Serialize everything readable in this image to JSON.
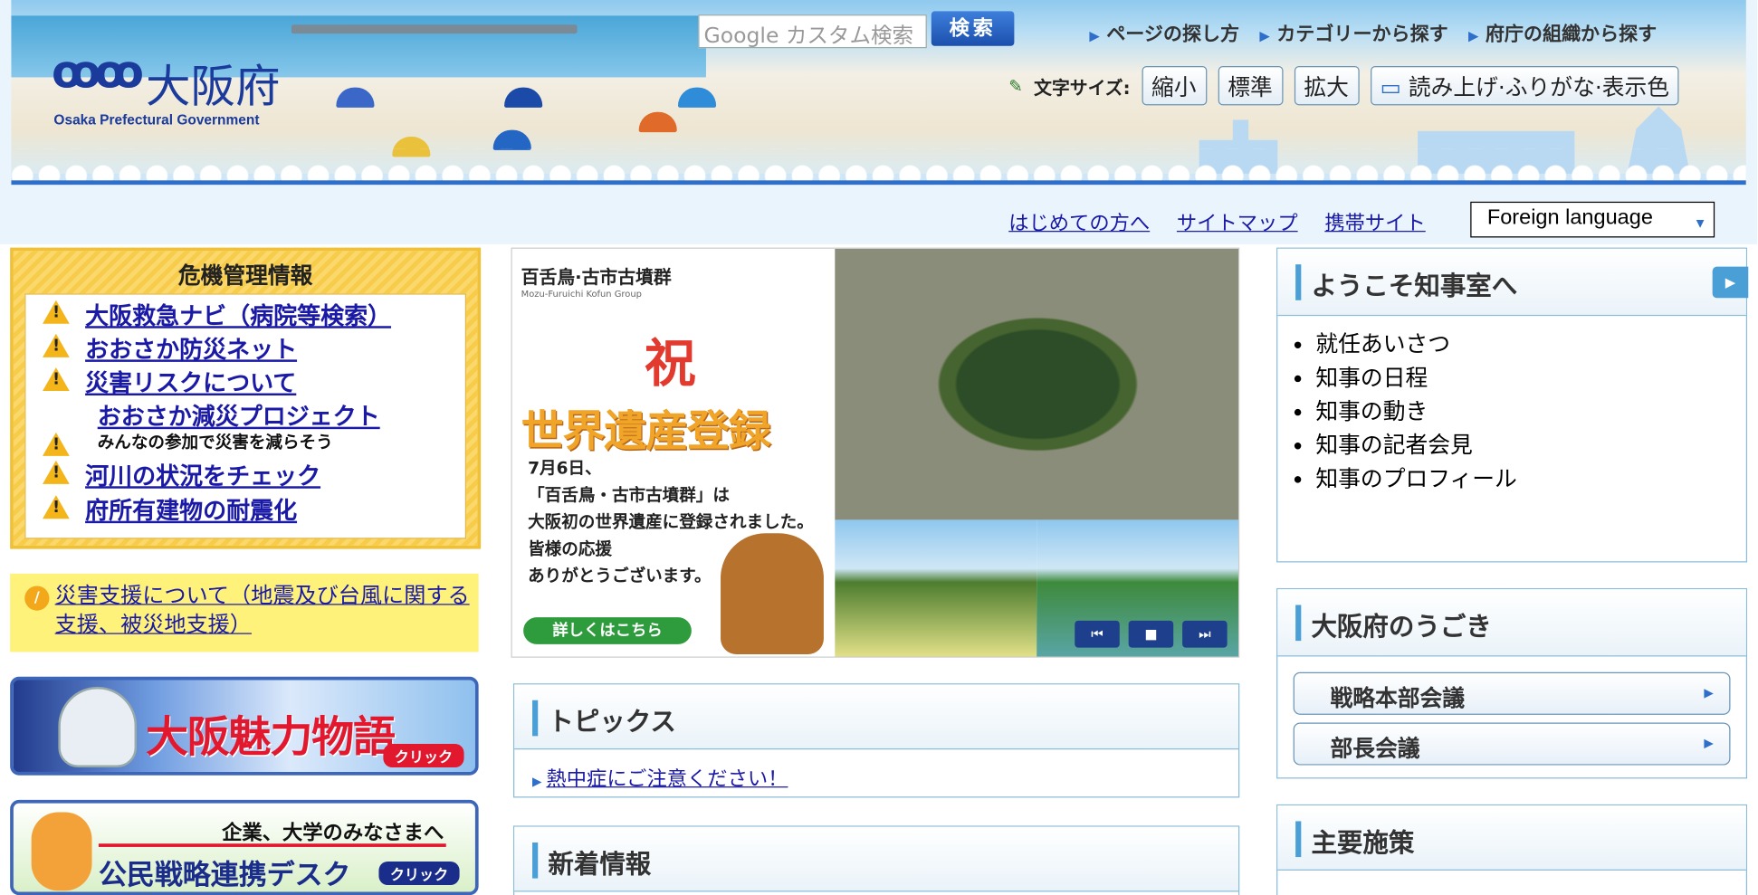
{
  "header": {
    "logo_jp": "大阪府",
    "logo_en": "Osaka Prefectural Government",
    "search_placeholder": "Google カスタム検索",
    "search_button": "検索",
    "top_links": [
      "ページの探し方",
      "カテゴリーから探す",
      "府庁の組織から探す"
    ],
    "font_size_label": "文字サイズ:",
    "font_buttons": [
      "縮小",
      "標準",
      "拡大"
    ],
    "accessibility_button": "読み上げ·ふりがな·表示色",
    "sub_links": [
      "はじめての方へ",
      "サイトマップ",
      "携帯サイト"
    ],
    "language_select": "Foreign language"
  },
  "crisis": {
    "title": "危機管理情報",
    "items": [
      "大阪救急ナビ（病院等検索）",
      "おおさか防災ネット",
      "災害リスクについて",
      "おおさか減災プロジェクト",
      "河川の状況をチェック",
      "府所有建物の耐震化"
    ],
    "sub_note": "みんなの参加で災害を減らそう"
  },
  "support_link": "災害支援について（地震及び台風に関する支援、被災地支援）",
  "banners": {
    "miryoku": {
      "title": "大阪魅力物語",
      "click": "クリック"
    },
    "desk": {
      "subtitle": "企業、大学のみなさまへ",
      "title": "公民戦略連携デスク",
      "click": "クリック"
    }
  },
  "slide": {
    "site_name": "百舌鳥·古市古墳群",
    "site_small": "Mozu-Furuichi Kofun Group",
    "celebration": "祝",
    "headline": "世界遺産登録",
    "body_lines": [
      "7月6日、",
      "「百舌鳥・古市古墳群」は",
      "大阪初の世界遺産に登録されました。",
      "皆様の応援",
      "ありがとうございます。"
    ],
    "detail_button": "詳しくはこちら",
    "controls": [
      "⏮",
      "■",
      "⏭"
    ]
  },
  "topics": {
    "title": "トピックス",
    "items": [
      "熱中症にご注意ください！"
    ]
  },
  "news": {
    "title": "新着情報"
  },
  "governor": {
    "title": "ようこそ知事室へ",
    "items": [
      "就任あいさつ",
      "知事の日程",
      "知事の動き",
      "知事の記者会見",
      "知事のプロフィール"
    ]
  },
  "movements": {
    "title": "大阪府のうごき",
    "items": [
      "戦略本部会議",
      "部長会議"
    ]
  },
  "policies": {
    "title": "主要施策"
  }
}
